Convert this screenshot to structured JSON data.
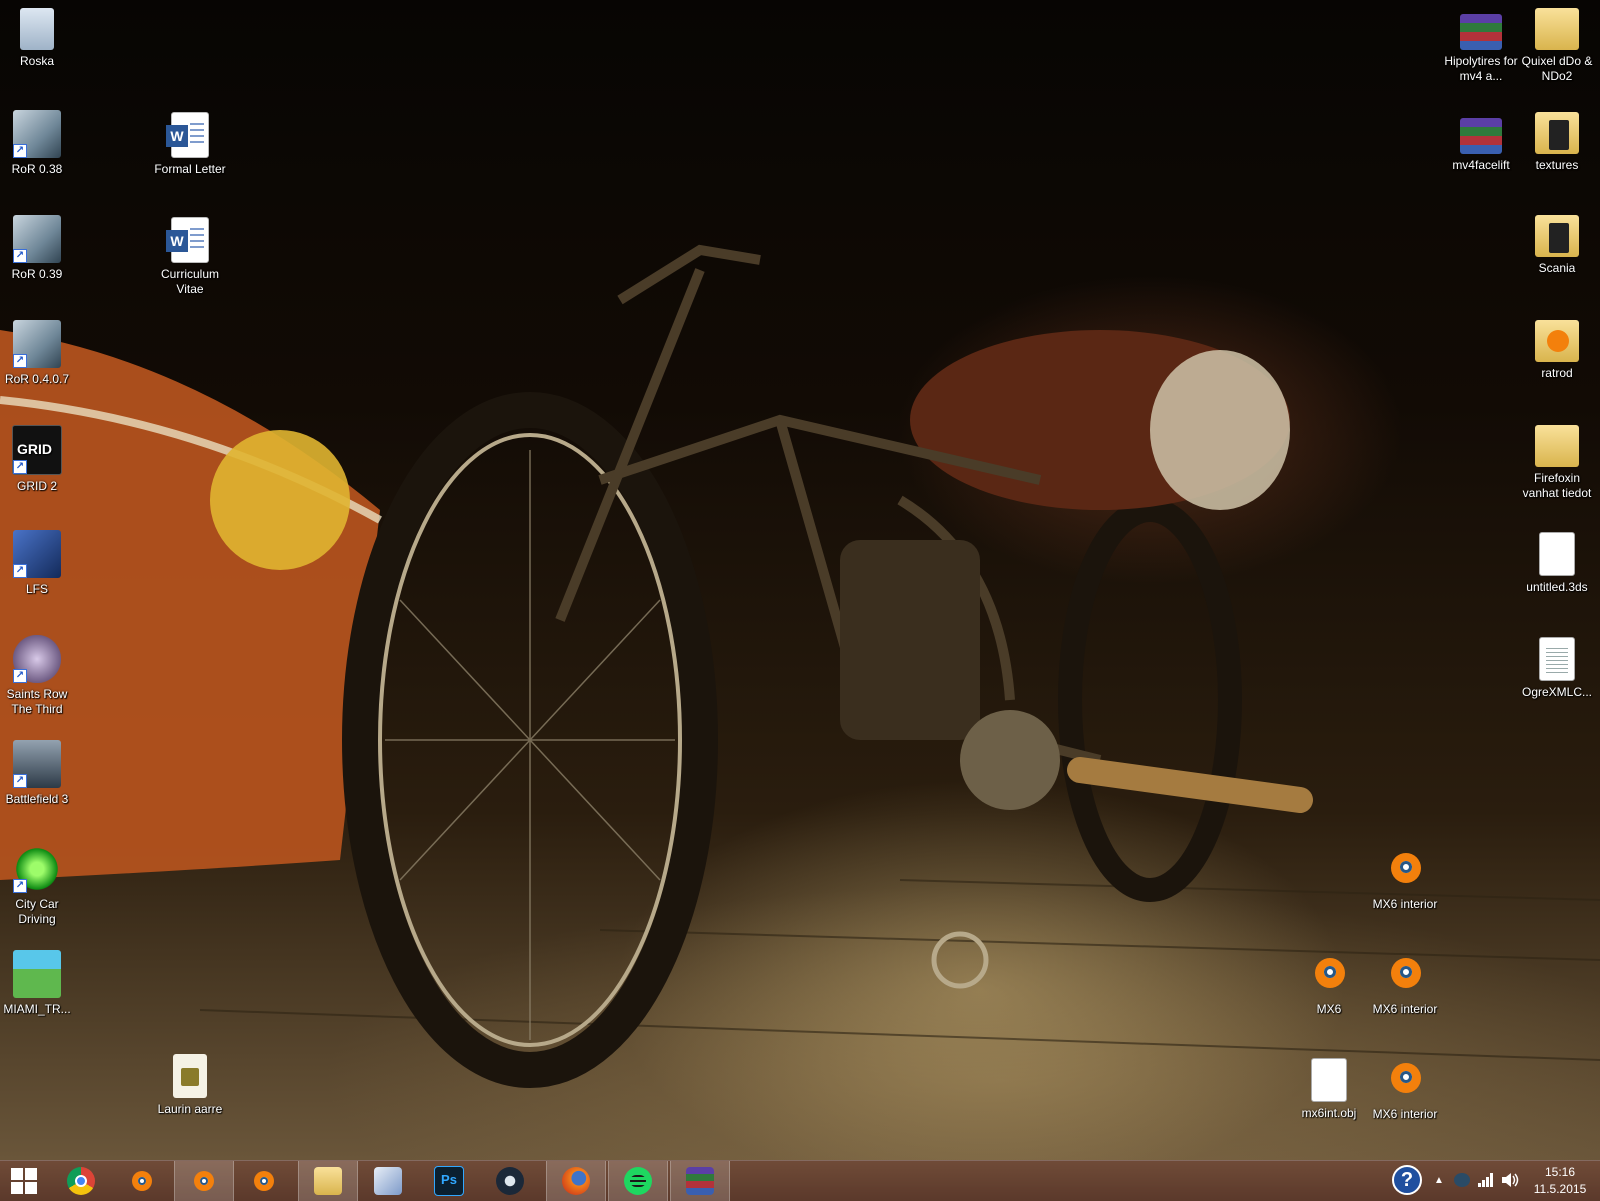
{
  "desktop": {
    "left_column": [
      {
        "label": "Roska",
        "icon": "recycle-bin-icon"
      },
      {
        "label": "RoR 0.38",
        "icon": "rigs-of-rods-icon"
      },
      {
        "label": "RoR 0.39",
        "icon": "rigs-of-rods-icon"
      },
      {
        "label": "RoR 0.4.0.7",
        "icon": "rigs-of-rods-icon"
      },
      {
        "label": "GRID 2",
        "icon": "grid2-icon"
      },
      {
        "label": "LFS",
        "icon": "lfs-icon"
      },
      {
        "label": "Saints Row The Third",
        "icon": "saints-row-icon"
      },
      {
        "label": "Battlefield 3",
        "icon": "battlefield3-icon"
      },
      {
        "label": "City Car Driving",
        "icon": "city-car-driving-icon"
      },
      {
        "label": "MIAMI_TR...",
        "icon": "miami-icon"
      }
    ],
    "second_column": [
      {
        "label": "Formal Letter",
        "icon": "word-document-icon"
      },
      {
        "label": "Curriculum Vitae",
        "icon": "word-document-icon"
      },
      {
        "label": "Laurin aarre",
        "icon": "image-file-icon"
      }
    ],
    "right_column": [
      {
        "label": "Hipolytires for mv4 a...",
        "icon": "rar-archive-icon"
      },
      {
        "label": "Quixel dDo & NDo2",
        "icon": "folder-icon"
      },
      {
        "label": "mv4facelift",
        "icon": "rar-archive-icon"
      },
      {
        "label": "textures",
        "icon": "folder-icon"
      },
      {
        "label": "Scania",
        "icon": "folder-icon"
      },
      {
        "label": "ratrod",
        "icon": "blender-folder-icon"
      },
      {
        "label": "Firefoxin vanhat tiedot",
        "icon": "folder-icon"
      },
      {
        "label": "untitled.3ds",
        "icon": "file-icon"
      },
      {
        "label": "OgreXMLC...",
        "icon": "text-file-icon"
      },
      {
        "label": "MX6 interior",
        "icon": "blender-icon"
      },
      {
        "label": "MX6",
        "icon": "blender-icon"
      },
      {
        "label": "MX6 interior",
        "icon": "blender-icon"
      },
      {
        "label": "mx6int.obj",
        "icon": "file-icon"
      },
      {
        "label": "MX6 interior",
        "icon": "blender-icon"
      }
    ]
  },
  "taskbar": {
    "ps_label": "Ps",
    "pinned": [
      {
        "name": "start-button",
        "icon": "windows-logo-icon"
      },
      {
        "name": "chrome",
        "icon": "chrome-icon"
      },
      {
        "name": "blender-1",
        "icon": "blender-icon"
      },
      {
        "name": "blender-2",
        "icon": "blender-icon",
        "active": true
      },
      {
        "name": "blender-3",
        "icon": "blender-icon"
      },
      {
        "name": "file-explorer",
        "icon": "folder-icon"
      },
      {
        "name": "paint",
        "icon": "paint-icon"
      },
      {
        "name": "photoshop",
        "icon": "photoshop-icon"
      },
      {
        "name": "steam",
        "icon": "steam-icon"
      },
      {
        "name": "firefox",
        "icon": "firefox-icon"
      },
      {
        "name": "spotify",
        "icon": "spotify-icon"
      },
      {
        "name": "winrar",
        "icon": "winrar-icon"
      }
    ],
    "tray": {
      "help_label": "?",
      "chevron": "▲",
      "clock_time": "15:16",
      "clock_date": "11.5.2015"
    }
  }
}
